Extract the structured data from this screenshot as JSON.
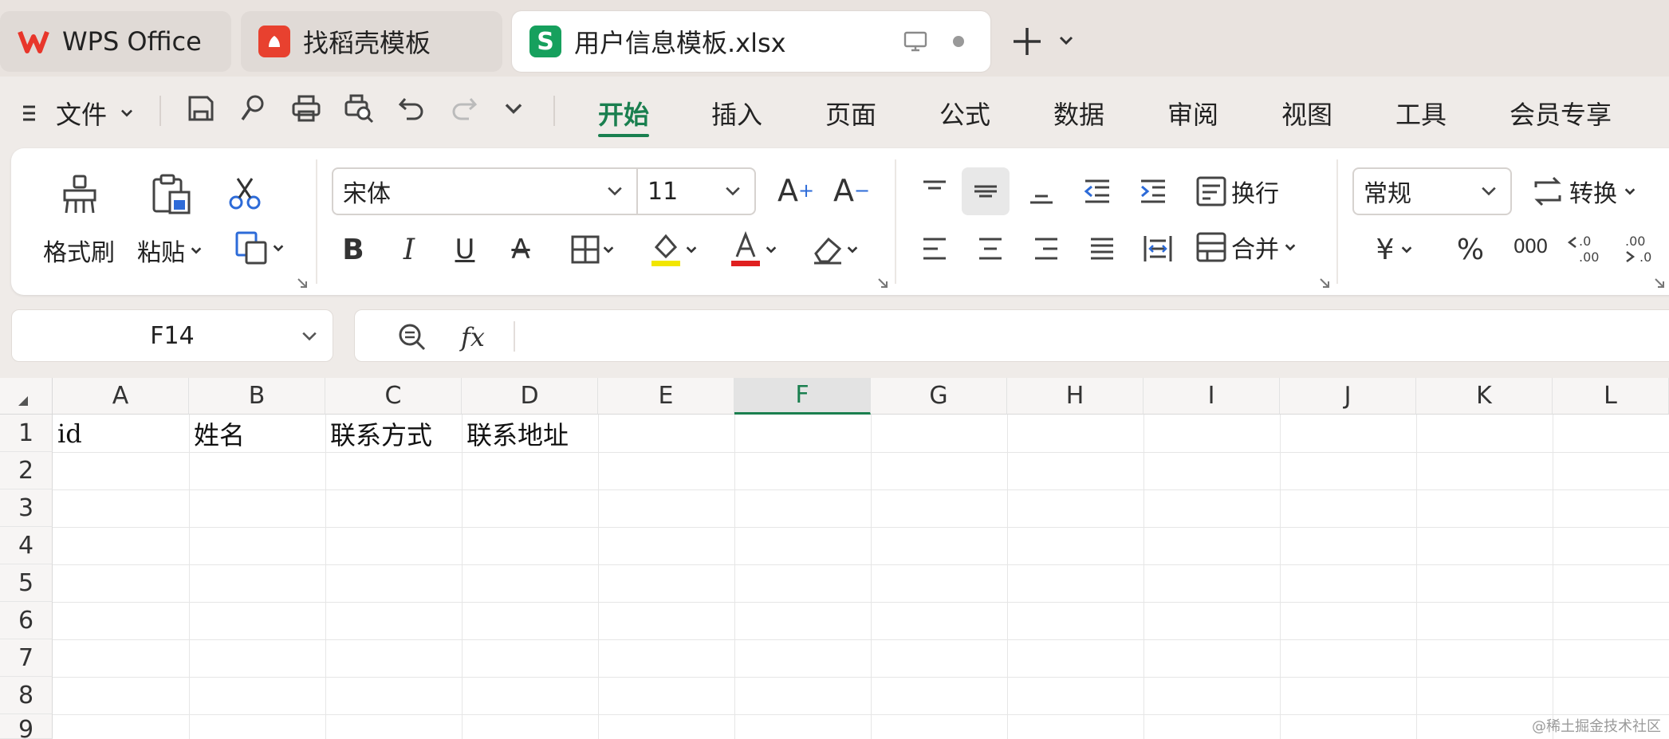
{
  "tabs": [
    {
      "label": "WPS Office",
      "icon": "wps-logo-icon"
    },
    {
      "label": "找稻壳模板",
      "icon": "docer-icon"
    },
    {
      "label": "用户信息模板.xlsx",
      "icon": "spreadsheet-icon",
      "icon_text": "S",
      "active": true
    }
  ],
  "menu": {
    "file_label": "文件",
    "ribbon_tabs": [
      "开始",
      "插入",
      "页面",
      "公式",
      "数据",
      "审阅",
      "视图",
      "工具",
      "会员专享"
    ],
    "active_tab": "开始"
  },
  "ribbon": {
    "format_painter": "格式刷",
    "paste": "粘贴",
    "font_name": "宋体",
    "font_size": "11",
    "wrap": "换行",
    "merge": "合并",
    "number_format": "常规",
    "convert": "转换",
    "percent": "%",
    "thousands": "000",
    "font_color": "#e02020",
    "highlight_color": "#f2e600"
  },
  "formula_bar": {
    "cell_ref": "F14",
    "fx": "fx",
    "content": ""
  },
  "sheet": {
    "columns": [
      "A",
      "B",
      "C",
      "D",
      "E",
      "F",
      "G",
      "H",
      "I",
      "J",
      "K",
      "L"
    ],
    "selected_column": "F",
    "rows": [
      "1",
      "2",
      "3",
      "4",
      "5",
      "6",
      "7",
      "8",
      "9"
    ],
    "cells": {
      "A1": "id",
      "B1": "姓名",
      "C1": "联系方式",
      "D1": "联系地址"
    }
  },
  "watermark": "@稀土掘金技术社区",
  "accent": "#1a7f4f"
}
